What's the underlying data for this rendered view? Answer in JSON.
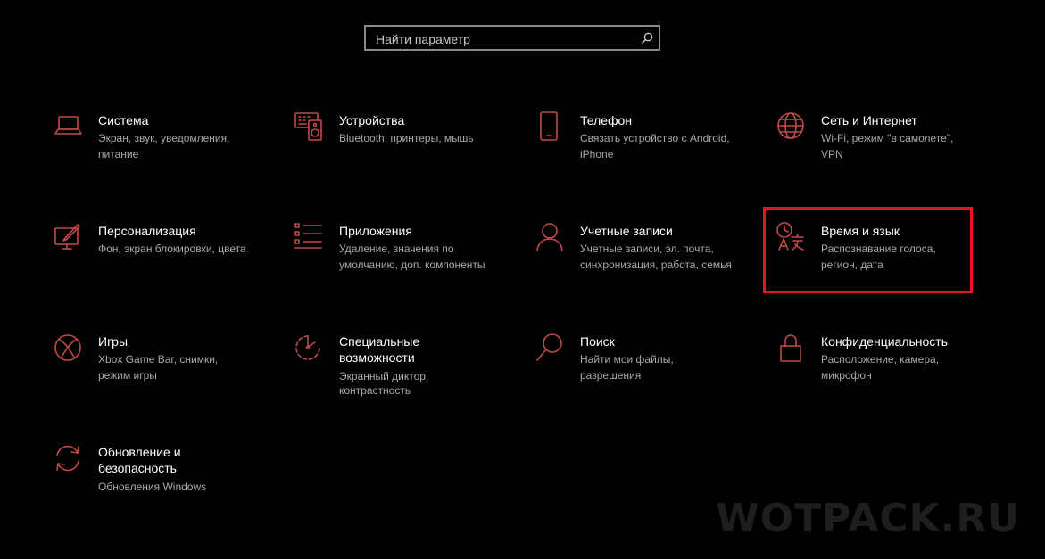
{
  "search": {
    "placeholder": "Найти параметр",
    "icon": "search-icon"
  },
  "accent_color": "#c04a4a",
  "highlight_color": "#e0171e",
  "tiles": [
    {
      "title": "Система",
      "desc": "Экран, звук, уведомления, питание",
      "desc1": "Экран, звук, уведомления,",
      "desc2": "питание",
      "icon": "laptop-icon"
    },
    {
      "title": "Устройства",
      "desc": "Bluetooth, принтеры, мышь",
      "desc1": "Bluetooth, принтеры, мышь",
      "desc2": "",
      "icon": "devices-icon"
    },
    {
      "title": "Телефон",
      "desc": "Связать устройство с Android, iPhone",
      "desc1": "Связать устройство с Android,",
      "desc2": "iPhone",
      "icon": "phone-icon"
    },
    {
      "title": "Сеть и Интернет",
      "desc": "Wi-Fi, режим \"в самолете\", VPN",
      "desc1": "Wi-Fi, режим \"в самолете\",",
      "desc2": "VPN",
      "icon": "globe-icon"
    },
    {
      "title": "Персонализация",
      "desc": "Фон, экран блокировки, цвета",
      "desc1": "Фон, экран блокировки, цвета",
      "desc2": "",
      "icon": "personalization-icon"
    },
    {
      "title": "Приложения",
      "desc": "Удаление, значения по умолчанию, доп. компоненты",
      "desc1": "Удаление, значения по",
      "desc2": "умолчанию, доп. компоненты",
      "icon": "apps-list-icon"
    },
    {
      "title": "Учетные записи",
      "desc": "Учетные записи, эл. почта, синхронизация, работа, семья",
      "desc1": "Учетные записи, эл. почта,",
      "desc2": "синхронизация, работа, семья",
      "icon": "person-icon"
    },
    {
      "title": "Время и язык",
      "desc": "Распознавание голоса, регион, дата",
      "desc1": "Распознавание голоса,",
      "desc2": "регион, дата",
      "icon": "time-language-icon"
    },
    {
      "title": "Игры",
      "desc": "Xbox Game Bar, снимки, режим игры",
      "desc1": "Xbox Game Bar, снимки,",
      "desc2": "режим игры",
      "icon": "xbox-icon"
    },
    {
      "title1": "Специальные",
      "title2": "возможности",
      "desc1": "Экранный диктор,",
      "desc2": "контрастность",
      "icon": "accessibility-icon"
    },
    {
      "title": "Поиск",
      "desc1": "Найти мои файлы,",
      "desc2": "разрешения",
      "icon": "search-magnifier-icon"
    },
    {
      "title": "Конфиденциальность",
      "desc1": "Расположение, камера,",
      "desc2": "микрофон",
      "icon": "lock-icon"
    },
    {
      "title1": "Обновление и",
      "title2": "безопасность",
      "desc1": "Обновления Windows",
      "icon": "update-icon"
    }
  ],
  "watermark": "WOTPACK.RU"
}
